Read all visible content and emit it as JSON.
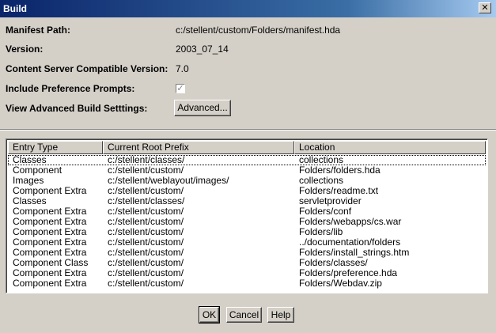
{
  "window": {
    "title": "Build",
    "close_glyph": "✕"
  },
  "fields": {
    "manifest_path": {
      "label": "Manifest Path:",
      "value": "c:/stellent/custom/Folders/manifest.hda"
    },
    "version": {
      "label": "Version:",
      "value": "2003_07_14"
    },
    "compatible_version": {
      "label": "Content Server Compatible Version:",
      "value": "7.0"
    },
    "include_prompts": {
      "label": "Include Preference Prompts:",
      "checked": true,
      "check_glyph": "✓"
    },
    "advanced": {
      "label": "View Advanced Build Setttings:",
      "button_label": "Advanced..."
    }
  },
  "table": {
    "columns": [
      "Entry Type",
      "Current Root Prefix",
      "Location"
    ],
    "rows": [
      [
        "Classes",
        "c:/stellent/classes/",
        "collections"
      ],
      [
        "Component",
        "c:/stellent/custom/",
        "Folders/folders.hda"
      ],
      [
        "Images",
        "c:/stellent/weblayout/images/",
        "collections"
      ],
      [
        "Component Extra",
        "c:/stellent/custom/",
        "Folders/readme.txt"
      ],
      [
        "Classes",
        "c:/stellent/classes/",
        "servletprovider"
      ],
      [
        "Component Extra",
        "c:/stellent/custom/",
        "Folders/conf"
      ],
      [
        "Component Extra",
        "c:/stellent/custom/",
        "Folders/webapps/cs.war"
      ],
      [
        "Component Extra",
        "c:/stellent/custom/",
        "Folders/lib"
      ],
      [
        "Component Extra",
        "c:/stellent/custom/",
        "../documentation/folders"
      ],
      [
        "Component Extra",
        "c:/stellent/custom/",
        "Folders/install_strings.htm"
      ],
      [
        "Component Class",
        "c:/stellent/custom/",
        "Folders/classes/"
      ],
      [
        "Component Extra",
        "c:/stellent/custom/",
        "Folders/preference.hda"
      ],
      [
        "Component Extra",
        "c:/stellent/custom/",
        "Folders/Webdav.zip"
      ]
    ]
  },
  "buttons": {
    "ok": "OK",
    "cancel": "Cancel",
    "help": "Help"
  }
}
